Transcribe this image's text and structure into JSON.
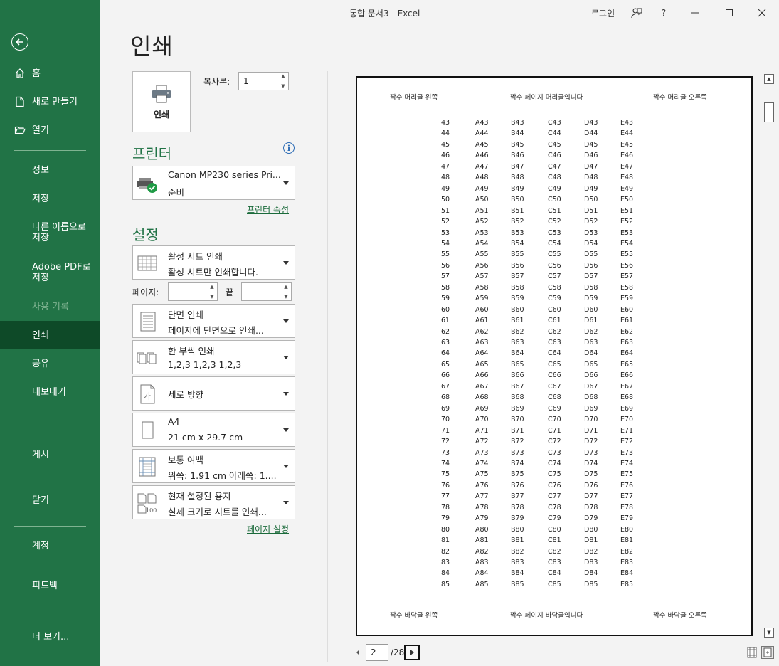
{
  "window": {
    "title": "통합 문서3  -  Excel",
    "login": "로그인",
    "help": "?"
  },
  "sidebar": {
    "items": [
      {
        "label": "홈"
      },
      {
        "label": "새로 만들기"
      },
      {
        "label": "열기"
      },
      {
        "label": "정보"
      },
      {
        "label": "저장"
      },
      {
        "label": "다른 이름으로\n저장"
      },
      {
        "label": "Adobe PDF로\n저장"
      },
      {
        "label": "사용 기록"
      },
      {
        "label": "인쇄"
      },
      {
        "label": "공유"
      },
      {
        "label": "내보내기"
      },
      {
        "label": "게시"
      },
      {
        "label": "닫기"
      },
      {
        "label": "계정"
      },
      {
        "label": "피드백"
      },
      {
        "label": "더 보기..."
      }
    ]
  },
  "print": {
    "page_title": "인쇄",
    "print_button": "인쇄",
    "copies_label": "복사본:",
    "copies_value": "1",
    "printer_heading": "프린터",
    "printer_name": "Canon MP230 series Pri...",
    "printer_status": "준비",
    "printer_props_link": "프린터 속성",
    "settings_heading": "설정",
    "settings": [
      {
        "line1": "활성 시트 인쇄",
        "line2": "활성 시트만 인쇄합니다."
      },
      {
        "line1": "단면 인쇄",
        "line2": "페이지에 단면으로 인쇄..."
      },
      {
        "line1": "한 부씩 인쇄",
        "line2": "1,2,3      1,2,3      1,2,3"
      },
      {
        "line1": "세로 방향",
        "line2": ""
      },
      {
        "line1": "A4",
        "line2": "21 cm x 29.7 cm"
      },
      {
        "line1": "보통 여백",
        "line2": "위쪽: 1.91 cm 아래쪽: 1...."
      },
      {
        "line1": "현재 설정된 용지",
        "line2": "실제 크기로 시트를 인쇄..."
      }
    ],
    "pages_label": "페이지:",
    "pages_to_label": "끝",
    "pages_from": "",
    "pages_to": "",
    "page_setup_link": "페이지 설정"
  },
  "preview": {
    "header_left": "짝수 머리글 왼쪽",
    "header_center": "짝수 페이지 머리글입니다",
    "header_right": "짝수 머리글 오른쪽",
    "footer_left": "짝수 바닥글 왼쪽",
    "footer_center": "짝수 페이지 바닥글입니다",
    "footer_right": "짝수 바닥글 오른쪽",
    "row_start": 43,
    "row_end": 85,
    "columns": [
      "A",
      "B",
      "C",
      "D",
      "E"
    ]
  },
  "navigation": {
    "current_page": "2",
    "total_pages": "/28"
  }
}
